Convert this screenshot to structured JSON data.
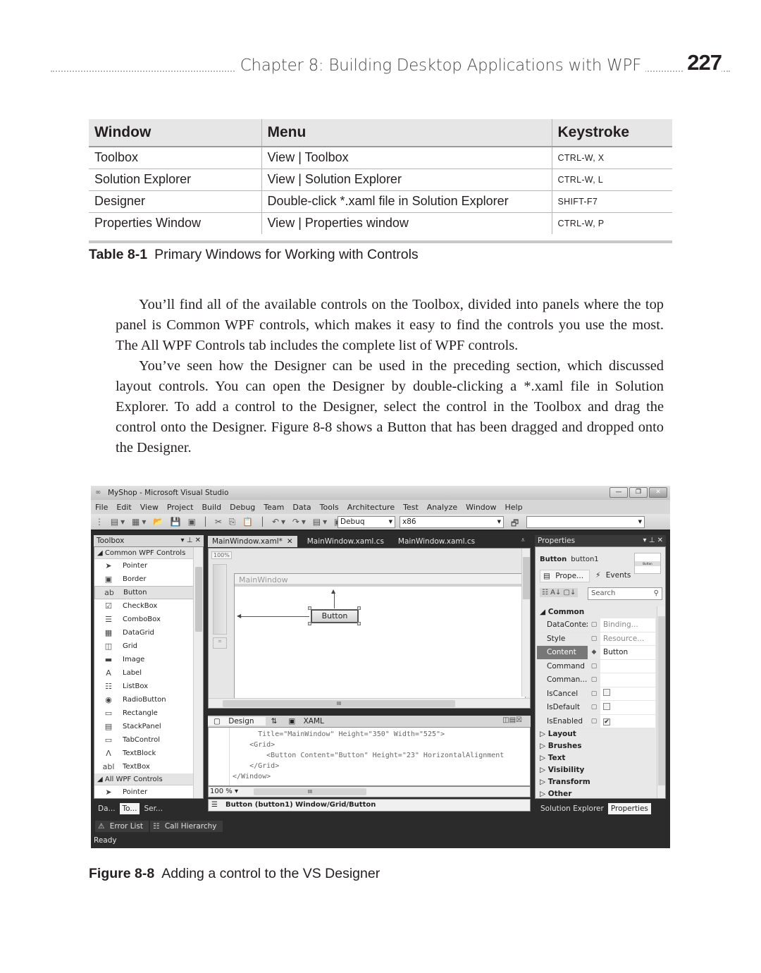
{
  "header": {
    "chapter_title": "Chapter 8:   Building Desktop Applications with WPF",
    "page_number": "227"
  },
  "table": {
    "columns": [
      "Window",
      "Menu",
      "Keystroke"
    ],
    "rows": [
      [
        "Toolbox",
        "View | Toolbox",
        "CTRL-W, X"
      ],
      [
        "Solution Explorer",
        "View | Solution Explorer",
        "CTRL-W, L"
      ],
      [
        "Designer",
        "Double-click *.xaml file in Solution Explorer",
        "SHIFT-F7"
      ],
      [
        "Properties Window",
        "View | Properties window",
        "CTRL-W, P"
      ]
    ],
    "caption_label": "Table 8-1",
    "caption_text": "Primary Windows for Working with Controls"
  },
  "body": {
    "paragraphs": [
      "You’ll find all of the available controls on the Toolbox, divided into panels where the top panel is Common WPF controls, which makes it easy to find the controls you use the most. The All WPF Controls tab includes the complete list of WPF controls.",
      "You’ve seen how the Designer can be used in the preceding section, which discussed layout controls. You can open the Designer by double-clicking a *.xaml file in Solution Explorer. To add a control to the Designer, select the control in the Toolbox and drag the control onto the Designer. Figure 8-8 shows a Button that has been dragged and dropped onto the Designer."
    ]
  },
  "figure": {
    "caption_label": "Figure 8-8",
    "caption_text": "Adding a control to the VS Designer",
    "vs": {
      "window_title": "MyShop - Microsoft Visual Studio",
      "menu": [
        "File",
        "Edit",
        "View",
        "Project",
        "Build",
        "Debug",
        "Team",
        "Data",
        "Tools",
        "Architecture",
        "Test",
        "Analyze",
        "Window",
        "Help"
      ],
      "toolbar": {
        "configuration": "Debuq",
        "platform": "x86",
        "find": ""
      },
      "toolbox": {
        "title": "Toolbox",
        "group_common": "Common WPF Controls",
        "items": [
          {
            "label": "Pointer",
            "icon": "➤"
          },
          {
            "label": "Border",
            "icon": "▣"
          },
          {
            "label": "Button",
            "icon": "ab"
          },
          {
            "label": "CheckBox",
            "icon": "☑"
          },
          {
            "label": "ComboBox",
            "icon": "☰"
          },
          {
            "label": "DataGrid",
            "icon": "▦"
          },
          {
            "label": "Grid",
            "icon": "◫"
          },
          {
            "label": "Image",
            "icon": "▬"
          },
          {
            "label": "Label",
            "icon": "A"
          },
          {
            "label": "ListBox",
            "icon": "☷"
          },
          {
            "label": "RadioButton",
            "icon": "◉"
          },
          {
            "label": "Rectangle",
            "icon": "▭"
          },
          {
            "label": "StackPanel",
            "icon": "▤"
          },
          {
            "label": "TabControl",
            "icon": "▭"
          },
          {
            "label": "TextBlock",
            "icon": "Ʌ"
          },
          {
            "label": "TextBox",
            "icon": "abl"
          }
        ],
        "selected": "Button",
        "group_all": "All WPF Controls",
        "all_first_item": "Pointer",
        "bottom_tabs": [
          "Da...",
          "To...",
          "Ser..."
        ],
        "active_bottom_tab": "To..."
      },
      "output_tabs": [
        "Error List",
        "Call Hierarchy"
      ],
      "status": "Ready",
      "doc_tabs": [
        "MainWindow.xaml*",
        "MainWindow.xaml.cs",
        "MainWindow.xaml.cs"
      ],
      "active_doc_tab": "MainWindow.xaml*",
      "designer": {
        "zoom": "100%",
        "window_title": "MainWindow",
        "button_label": "Button"
      },
      "split_tabs": {
        "design": "Design",
        "swap": "⇅",
        "xaml": "XAML"
      },
      "xaml_lines": [
        "      Title=\"MainWindow\" Height=\"350\" Width=\"525\">",
        "    <Grid>",
        "        <Button Content=\"Button\" Height=\"23\" HorizontalAlignment",
        "    </Grid>",
        "</Window>"
      ],
      "xaml_zoom": "100 %",
      "breadcrumb": "Button (button1)  Window/Grid/Button",
      "properties": {
        "title": "Properties",
        "type": "Button",
        "name": "button1",
        "preview_label": "Button",
        "tabs": [
          "Prope...",
          "Events"
        ],
        "search_placeholder": "Search",
        "category": "Common",
        "rows": [
          {
            "name": "DataContext",
            "value": "Binding...",
            "dim": true
          },
          {
            "name": "Style",
            "value": "Resource...",
            "dim": true
          },
          {
            "name": "Content",
            "value": "Button",
            "selected": true
          },
          {
            "name": "Command",
            "value": ""
          },
          {
            "name": "Comman...",
            "value": ""
          },
          {
            "name": "IsCancel",
            "checkbox": false
          },
          {
            "name": "IsDefault",
            "checkbox": false
          },
          {
            "name": "IsEnabled",
            "checkbox": true
          }
        ],
        "collapsed_categories": [
          "Layout",
          "Brushes",
          "Text",
          "Visibility",
          "Transform",
          "Other"
        ],
        "bottom_tabs": [
          "Solution Explorer",
          "Properties"
        ],
        "active_bottom_tab": "Properties"
      }
    }
  }
}
